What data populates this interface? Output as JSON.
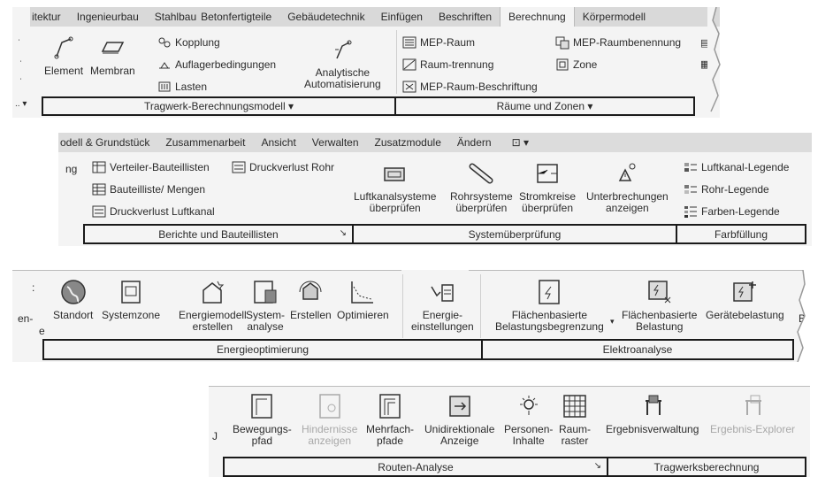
{
  "s1": {
    "tabs": [
      "itektur",
      "Ingenieurbau",
      "Stahlbau",
      "Betonfertigteile",
      "Gebäudetechnik",
      "Einfügen",
      "Beschriften",
      "Berechnung",
      "Körpermodell"
    ],
    "element": "Element",
    "membran": "Membran",
    "kopplung": "Kopplung",
    "auflager": "Auflagerbedingungen",
    "lasten": "Lasten",
    "analytische1": "Analytische",
    "analytische2": "Automatisierung",
    "mep_raum": "MEP-Raum",
    "raumtrennung": "Raum-trennung",
    "mep_beschriftung": "MEP-Raum-Beschriftung",
    "mep_benennung": "MEP-Raumbenennung",
    "zone": "Zone",
    "panel_tragwerk": "Tragwerk-Berechnungsmodell ▾",
    "panel_raeume": "Räume und Zonen ▾"
  },
  "s2": {
    "tabs": [
      "odell & Grundstück",
      "Zusammenarbeit",
      "Ansicht",
      "Verwalten",
      "Zusatzmodule",
      "Ändern",
      "⊡ ▾"
    ],
    "ng": "ng",
    "verteiler": "Verteiler-Bauteillisten",
    "druckverlust_rohr": "Druckverlust Rohr",
    "bauteilliste": "Bauteilliste/ Mengen",
    "druckverlust_luft": "Druckverlust Luftkanal",
    "luftkanal1": "Luftkanalsysteme",
    "luftkanal2": "überprüfen",
    "rohr1": "Rohrsysteme",
    "rohr2": "überprüfen",
    "strom1": "Stromkreise",
    "strom2": "überprüfen",
    "unter1": "Unterbrechungen",
    "unter2": "anzeigen",
    "legende_luft": "Luftkanal-Legende",
    "legende_rohr": "Rohr-Legende",
    "legende_farben": "Farben-Legende",
    "panel_berichte": "Berichte und Bauteillisten",
    "panel_system": "Systemüberprüfung",
    "panel_farb": "Farbfüllung",
    "arrow": "↘"
  },
  "s3": {
    "en": "en-",
    "e": "e",
    "standort": "Standort",
    "systemzone": "Systemzone",
    "energiemodell1": "Energiemodell",
    "energiemodell2": "erstellen",
    "system1": "System-",
    "system2": "analyse",
    "erstellen": "Erstellen",
    "optimieren": "Optimieren",
    "energie1": "Energie-",
    "energie2": "einstellungen",
    "flaeche1a": "Flächenbasierte",
    "flaeche1b": "Belastungsbegrenzung",
    "flaeche2a": "Flächenbasierte",
    "flaeche2b": "Belastung",
    "geraete": "Gerätebelastung",
    "be": "Be",
    "panel_energie": "Energieoptimierung",
    "panel_elektro": "Elektroanalyse"
  },
  "s4": {
    "j": "J",
    "bewegung1": "Bewegungs-",
    "bewegung2": "pfad",
    "hindernis1": "Hindernisse",
    "hindernis2": "anzeigen",
    "mehrfach1": "Mehrfach-",
    "mehrfach2": "pfade",
    "unidir1": "Unidirektionale",
    "unidir2": "Anzeige",
    "personen1": "Personen-",
    "personen2": "Inhalte",
    "raum1": "Raum-",
    "raum2": "raster",
    "ergebnis": "Ergebnisverwaltung",
    "explorer": "Ergebnis-Explorer",
    "panel_routen": "Routen-Analyse",
    "panel_tragwerk": "Tragwerksberechnung",
    "arrow": "↘"
  }
}
